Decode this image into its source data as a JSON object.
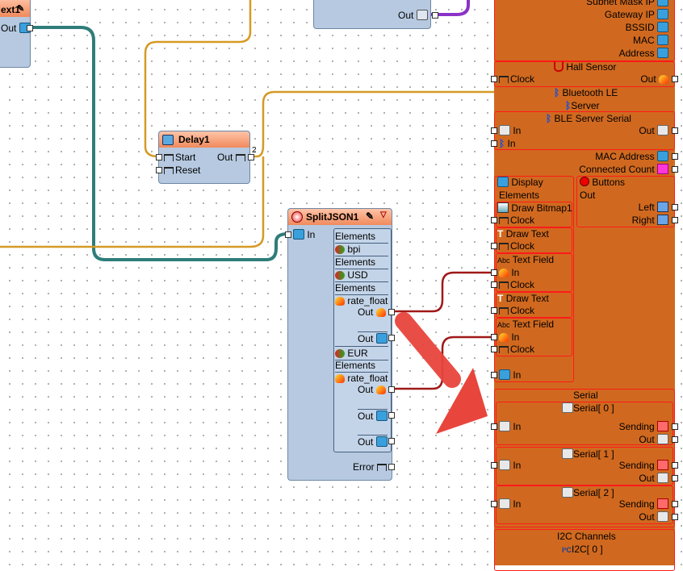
{
  "top_left_comp": {
    "title_fragment": "ext1",
    "out_label": "Out"
  },
  "top_comp": {
    "out_label": "Out"
  },
  "delay": {
    "title": "Delay1",
    "start": "Start",
    "reset": "Reset",
    "out": "Out",
    "badge": "2"
  },
  "split": {
    "title": "SplitJSON1",
    "in_label": "In",
    "items": [
      {
        "label": "Elements"
      },
      {
        "label": "bpi"
      },
      {
        "label": "Elements"
      },
      {
        "label": "USD"
      },
      {
        "label": "Elements"
      },
      {
        "label": "rate_float"
      },
      {
        "label": "Out"
      },
      {
        "label": "Out"
      },
      {
        "label": "EUR"
      },
      {
        "label": "Elements"
      },
      {
        "label": "rate_float"
      },
      {
        "label": "Out"
      },
      {
        "label": "Out"
      },
      {
        "label": "Out"
      }
    ],
    "error_label": "Error"
  },
  "board": {
    "wifi": {
      "subnet": "Subnet Mask IP",
      "gateway": "Gateway IP",
      "bssid": "BSSID",
      "mac": "MAC",
      "address": "Address"
    },
    "hall": {
      "title": "Hall Sensor",
      "clock": "Clock",
      "out": "Out"
    },
    "ble": {
      "title": "Bluetooth LE",
      "server": "Server",
      "serial_title": "BLE Server Serial",
      "in1": "In",
      "out": "Out",
      "in2": "In",
      "mac": "MAC Address",
      "count": "Connected Count"
    },
    "display": {
      "title": "Display",
      "elements": "Elements",
      "items": [
        {
          "title": "Draw Bitmap1",
          "pin": "Clock"
        },
        {
          "title": "Draw Text",
          "pin": "Clock"
        },
        {
          "title": "Text Field",
          "pin1": "In",
          "pin2": "Clock"
        },
        {
          "title": "Draw Text",
          "pin": "Clock"
        },
        {
          "title": "Text Field",
          "pin1": "In",
          "pin2": "Clock"
        }
      ],
      "in": "In"
    },
    "buttons": {
      "title": "Buttons",
      "out": "Out",
      "left": "Left",
      "right": "Right"
    },
    "serial": {
      "title": "Serial",
      "ports": [
        {
          "name": "Serial[ 0 ]",
          "in": "In",
          "sending": "Sending",
          "out": "Out"
        },
        {
          "name": "Serial[ 1 ]",
          "in": "In",
          "sending": "Sending",
          "out": "Out"
        },
        {
          "name": "Serial[ 2 ]",
          "in": "In",
          "sending": "Sending",
          "out": "Out"
        }
      ]
    },
    "i2c": {
      "title": "I2C Channels",
      "port": "I2C[ 0 ]"
    }
  },
  "colors": {
    "board": "#d0691f",
    "component": "#b6c9e0",
    "wire_teal": "#2e7d7a",
    "wire_gold": "#d59a25",
    "wire_purple": "#8a32c8",
    "wire_red": "#a01818",
    "arrow": "#e8453c"
  }
}
